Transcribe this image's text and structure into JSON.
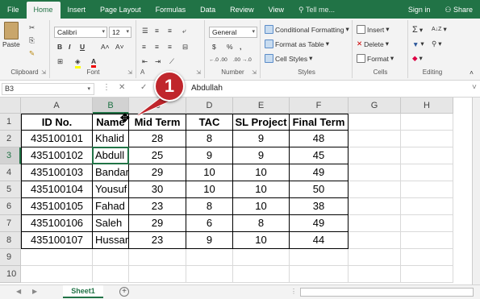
{
  "ribbon_tabs": [
    {
      "label": "File",
      "active": false
    },
    {
      "label": "Home",
      "active": true
    },
    {
      "label": "Insert",
      "active": false
    },
    {
      "label": "Page Layout",
      "active": false
    },
    {
      "label": "Formulas",
      "active": false
    },
    {
      "label": "Data",
      "active": false
    },
    {
      "label": "Review",
      "active": false
    },
    {
      "label": "View",
      "active": false
    }
  ],
  "tell_me": "Tell me...",
  "sign_in": "Sign in",
  "share": "Share",
  "clipboard": {
    "paste": "Paste",
    "label": "Clipboard"
  },
  "font": {
    "name": "Calibri",
    "size": "12",
    "label": "Font",
    "bold": "B",
    "italic": "I",
    "underline": "U",
    "grow": "A˄",
    "shrink": "A˅"
  },
  "alignment": {
    "label": "A"
  },
  "number": {
    "format": "General",
    "currency": "$",
    "percent": "%",
    "comma": ",",
    "inc": "←.0 .00",
    "dec": ".00 →.0",
    "label": "Number"
  },
  "styles": {
    "conditional": "Conditional Formatting",
    "table": "Format as Table",
    "cell": "Cell Styles",
    "label": "Styles"
  },
  "cells": {
    "insert": "Insert",
    "delete": "Delete",
    "format": "Format",
    "label": "Cells"
  },
  "editing": {
    "sum": "Σ",
    "sort": "A↓Z",
    "label": "Editing"
  },
  "name_box": "B3",
  "formula_value": "Abdullah",
  "columns": [
    "A",
    "B",
    "C",
    "D",
    "E",
    "F",
    "G",
    "H"
  ],
  "rows": [
    "1",
    "2",
    "3",
    "4",
    "5",
    "6",
    "7",
    "8",
    "9",
    "10"
  ],
  "table": {
    "headers": [
      "ID No.",
      "Name",
      "Mid Term",
      "TAC",
      "SL Project",
      "Final Term"
    ],
    "records": [
      [
        "435100101",
        "Khalid",
        "28",
        "8",
        "9",
        "48"
      ],
      [
        "435100102",
        "Abdull",
        "25",
        "9",
        "9",
        "45"
      ],
      [
        "435100103",
        "Bandar",
        "29",
        "10",
        "10",
        "49"
      ],
      [
        "435100104",
        "Yousuf",
        "30",
        "10",
        "10",
        "50"
      ],
      [
        "435100105",
        "Fahad",
        "23",
        "8",
        "10",
        "38"
      ],
      [
        "435100106",
        "Saleh",
        "29",
        "6",
        "8",
        "49"
      ],
      [
        "435100107",
        "Hussar",
        "23",
        "9",
        "10",
        "44"
      ]
    ]
  },
  "callout_number": "1",
  "sheet_tab": "Sheet1",
  "colors": {
    "accent": "#217346",
    "callout": "#c0262c"
  }
}
